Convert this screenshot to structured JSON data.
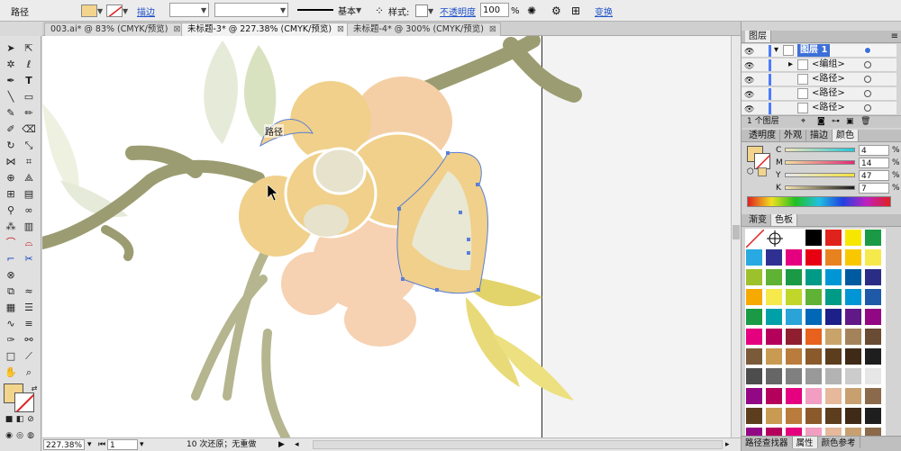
{
  "control_bar": {
    "selection_label": "路径",
    "stroke_label": "描边",
    "stroke_profile": "基本",
    "style_label": "样式:",
    "opacity_label": "不透明度",
    "opacity_value": "100",
    "percent": "%",
    "transform_label": "变换"
  },
  "tabs": [
    {
      "label": "003.ai* @ 83% (CMYK/预览)"
    },
    {
      "label": "未标题-3* @ 227.38% (CMYK/预览)"
    },
    {
      "label": "未标题-4* @ 300% (CMYK/预览)"
    }
  ],
  "tab_close": "⊠",
  "canvas": {
    "tooltip": "路径"
  },
  "status": {
    "zoom": "227.38%",
    "page": "1",
    "history": "10 次还原；无重做"
  },
  "layers_panel": {
    "title": "图层",
    "rows": [
      {
        "name": "图层 1"
      },
      {
        "name": "<编组>"
      },
      {
        "name": "<路径>"
      },
      {
        "name": "<路径>"
      },
      {
        "name": "<路径>"
      }
    ],
    "count": "1 个图层"
  },
  "color_panel": {
    "tabs": [
      "透明度",
      "外观",
      "描边",
      "颜色"
    ],
    "channels": [
      {
        "label": "C",
        "value": "4"
      },
      {
        "label": "M",
        "value": "14"
      },
      {
        "label": "Y",
        "value": "47"
      },
      {
        "label": "K",
        "value": "7"
      }
    ],
    "percent": "%",
    "fill_color": "#f2d48c"
  },
  "swatches_panel": {
    "tabs": [
      "渐变",
      "色板"
    ]
  },
  "bottom_tabs": [
    "路径查找器",
    "属性",
    "颜色参考"
  ]
}
